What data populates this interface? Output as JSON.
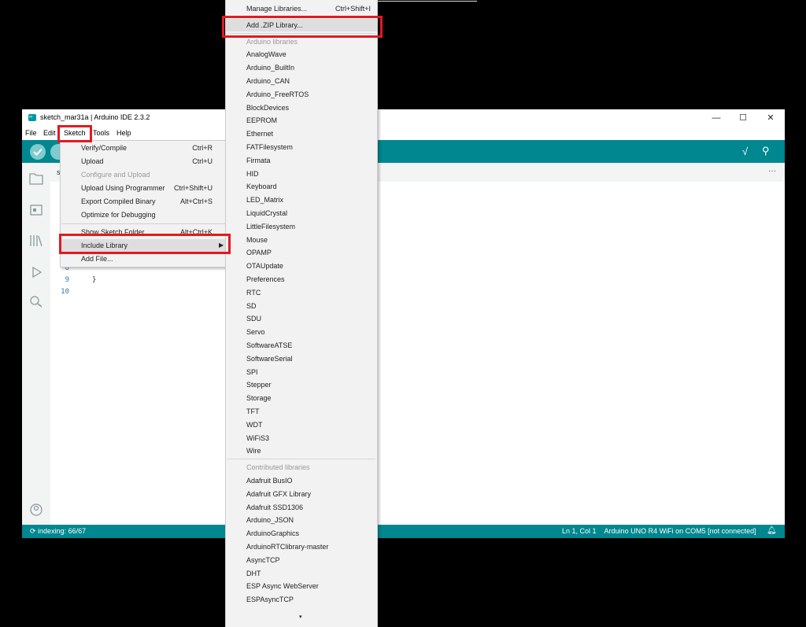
{
  "window": {
    "title": "sketch_mar31a | Arduino IDE 2.3.2",
    "logo_text": "∞",
    "controls": {
      "minimize": "—",
      "maximize": "☐",
      "close": "✕"
    }
  },
  "menubar": [
    "File",
    "Edit",
    "Sketch",
    "Tools",
    "Help"
  ],
  "editor": {
    "tab_label": "s",
    "more": "···",
    "line_numbers": [
      "8",
      "9",
      "10"
    ],
    "code_line_9": "}"
  },
  "statusbar": {
    "indexing": "indexing: 66/67",
    "position": "Ln 1, Col 1",
    "board": "Arduino UNO R4 WiFi on COM5 [not connected]"
  },
  "sketch_menu": [
    {
      "label": "Verify/Compile",
      "shortcut": "Ctrl+R",
      "disabled": false
    },
    {
      "label": "Upload",
      "shortcut": "Ctrl+U",
      "disabled": false
    },
    {
      "label": "Configure and Upload",
      "shortcut": "",
      "disabled": true
    },
    {
      "label": "Upload Using Programmer",
      "shortcut": "Ctrl+Shift+U",
      "disabled": false
    },
    {
      "label": "Export Compiled Binary",
      "shortcut": "Alt+Ctrl+S",
      "disabled": false
    },
    {
      "label": "Optimize for Debugging",
      "shortcut": "",
      "disabled": false
    },
    {
      "label": "Show Sketch Folder",
      "shortcut": "Alt+Ctrl+K",
      "disabled": false
    },
    {
      "label": "Include Library",
      "shortcut": "",
      "disabled": false,
      "submenu": true
    },
    {
      "label": "Add File...",
      "shortcut": "",
      "disabled": false
    }
  ],
  "library_menu": {
    "manage": {
      "label": "Manage Libraries...",
      "shortcut": "Ctrl+Shift+I"
    },
    "add_zip": "Add .ZIP Library...",
    "arduino_header": "Arduino libraries",
    "arduino_libraries": [
      "AnalogWave",
      "Arduino_BuiltIn",
      "Arduino_CAN",
      "Arduino_FreeRTOS",
      "BlockDevices",
      "EEPROM",
      "Ethernet",
      "FATFilesystem",
      "Firmata",
      "HID",
      "Keyboard",
      "LED_Matrix",
      "LiquidCrystal",
      "LittleFilesystem",
      "Mouse",
      "OPAMP",
      "OTAUpdate",
      "Preferences",
      "RTC",
      "SD",
      "SDU",
      "Servo",
      "SoftwareATSE",
      "SoftwareSerial",
      "SPI",
      "Stepper",
      "Storage",
      "TFT",
      "WDT",
      "WiFiS3",
      "Wire"
    ],
    "contributed_header": "Contributed libraries",
    "contributed_libraries": [
      "Adafruit BusIO",
      "Adafruit GFX Library",
      "Adafruit SSD1306",
      "Arduino_JSON",
      "ArduinoGraphics",
      "ArduinoRTClibrary-master",
      "AsyncTCP",
      "DHT",
      "ESP Async WebServer",
      "ESPAsyncTCP"
    ],
    "scroll_down": "▾"
  },
  "colors": {
    "teal": "#00878f",
    "highlight_red": "#e4191f"
  }
}
